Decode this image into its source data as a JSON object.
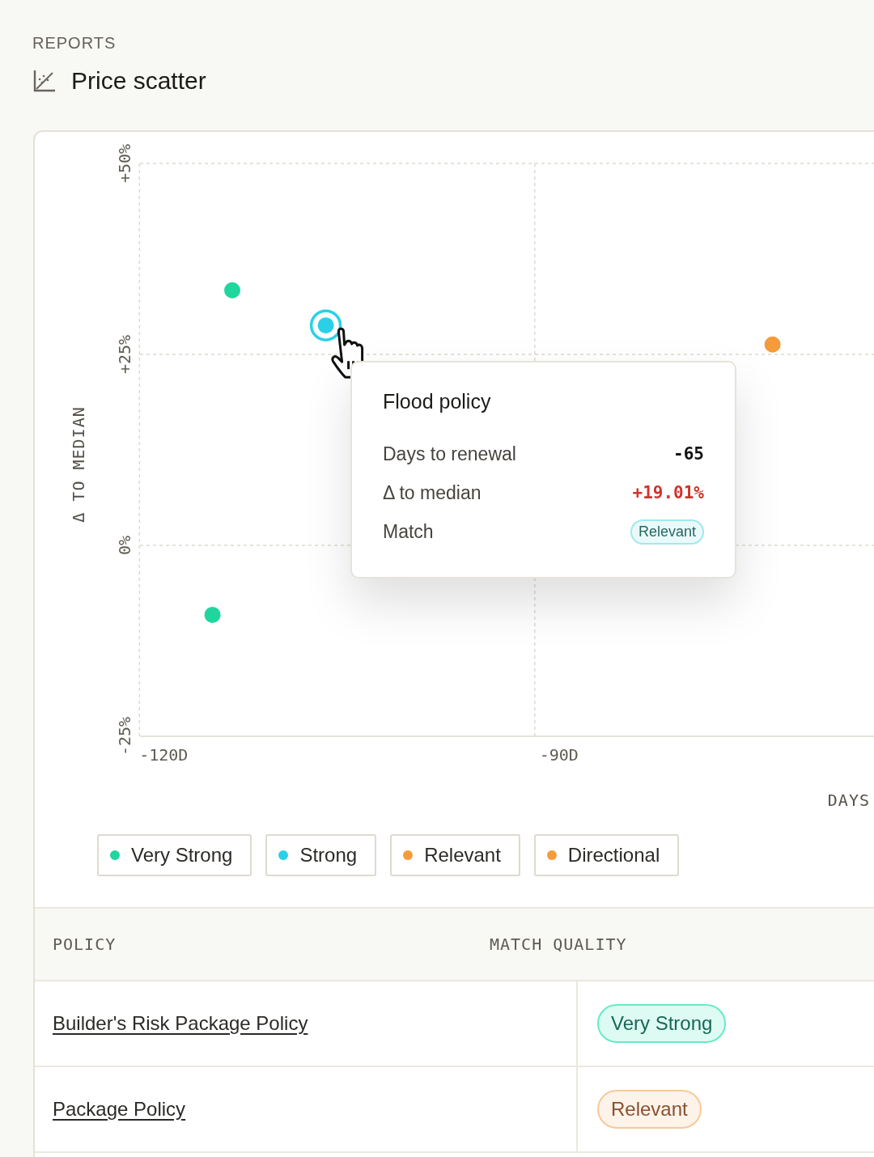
{
  "header": {
    "eyebrow": "REPORTS",
    "title": "Price scatter"
  },
  "chart": {
    "chart_data": {
      "type": "scatter",
      "ylabel": "Δ TO MEDIAN",
      "xlabel": "DAYS",
      "xlim": [
        -121.8,
        -66.1
      ],
      "ylim": [
        -25,
        50
      ],
      "xticks": [
        {
          "value": -120,
          "label": "-120D"
        },
        {
          "value": -90,
          "label": "-90D"
        }
      ],
      "yticks": [
        {
          "value": -25,
          "label": "-25%"
        },
        {
          "value": 0,
          "label": "0%"
        },
        {
          "value": 25,
          "label": "+25%"
        },
        {
          "value": 50,
          "label": "+50%"
        }
      ],
      "series": [
        {
          "name": "Very Strong",
          "color": "#1fd69e",
          "x": [
            -114.8,
            -116.3
          ],
          "values": [
            33.4,
            -9.1
          ]
        },
        {
          "name": "Strong",
          "color": "#2bd0e8",
          "x": [
            -107.7
          ],
          "values": [
            28.8
          ]
        },
        {
          "name": "Relevant",
          "color": "#f59b3a",
          "x": [
            null
          ],
          "values": [
            null
          ]
        },
        {
          "name": "Directional",
          "color": "#f59b3a",
          "x": [
            -73.8
          ],
          "values": [
            26.3
          ]
        }
      ]
    },
    "tooltip": {
      "title": "Flood policy",
      "rows": [
        {
          "kind": "number",
          "label": "Days to renewal",
          "value": "-65"
        },
        {
          "kind": "delta",
          "label": "Δ to median",
          "value": "+19.01%"
        },
        {
          "kind": "badge",
          "label": "Match",
          "value": "Relevant",
          "color": "#9fe9ef"
        }
      ]
    }
  },
  "table": {
    "columns": [
      "POLICY",
      "MATCH QUALITY"
    ],
    "rows": [
      {
        "policy": "Builder's Risk Package Policy",
        "match": "Very Strong",
        "color": "#66ebc6"
      },
      {
        "policy": "Package Policy",
        "match": "Relevant",
        "color": "#f6c999"
      }
    ]
  }
}
